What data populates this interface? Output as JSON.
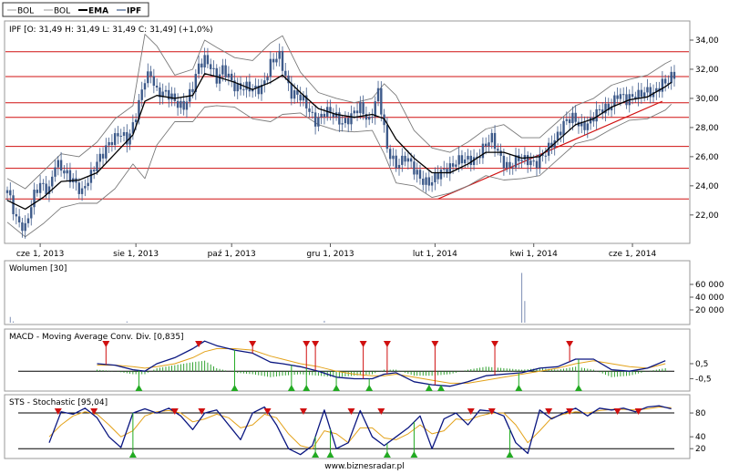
{
  "colors": {
    "price": "#3d5a8a",
    "bollinger": "#7a7a7a",
    "ema": "#000000",
    "resistance": "#d01010",
    "trend": "#d01010",
    "volume": "#7e8fb5",
    "macd_line": "#0a1680",
    "signal_line": "#e3a21a",
    "histogram": "#1f9a1f",
    "sell_marker": "#d01010",
    "buy_marker": "#22aa22",
    "frame": "#9a9a9a"
  },
  "legend": {
    "items": [
      {
        "label": "BOL",
        "style": "thin-gray"
      },
      {
        "label": "BOL",
        "style": "thin-gray"
      },
      {
        "label": "EMA",
        "style": "bold-black"
      },
      {
        "label": "IPF",
        "style": "blue"
      }
    ]
  },
  "footer": "www.biznesradar.pl",
  "chart_data": [
    {
      "type": "line",
      "id": "price",
      "title": "IPF [O: 31,49  H: 31,49  L: 31,49  C: 31,49] (+1,0%)",
      "y_tick_labels": [
        "22,00",
        "24,00",
        "26,00",
        "28,00",
        "30,00",
        "32,00",
        "34,00"
      ],
      "y_ticks": [
        22,
        24,
        26,
        28,
        30,
        32,
        34
      ],
      "ylim": [
        20.3,
        35
      ],
      "x_tick_labels": [
        "cze 1, 2013",
        "sie 1, 2013",
        "paź 1, 2013",
        "gru 1, 2013",
        "lut 1, 2014",
        "kwi 1, 2014",
        "cze 1, 2014"
      ],
      "x_tick_positions": [
        11,
        43,
        75,
        108,
        143,
        176,
        209
      ],
      "x_range": [
        0,
        223
      ],
      "horizontal_levels": [
        23.1,
        25.2,
        26.7,
        28.7,
        29.7,
        31.5,
        33.2
      ],
      "trendline": {
        "x": [
          144,
          219
        ],
        "y": [
          23.1,
          29.8
        ]
      },
      "series": [
        {
          "name": "IPF",
          "x": [
            0,
            3,
            6,
            9,
            11,
            14,
            16,
            19,
            22,
            25,
            28,
            30,
            33,
            36,
            38,
            40,
            42,
            44,
            46,
            48,
            50,
            53,
            56,
            59,
            62,
            64,
            66,
            68,
            70,
            72,
            74,
            76,
            79,
            82,
            85,
            88,
            91,
            93,
            95,
            97,
            100,
            103,
            106,
            109,
            112,
            115,
            118,
            121,
            124,
            127,
            130,
            133,
            136,
            139,
            142,
            144,
            147,
            150,
            153,
            156,
            159,
            162,
            165,
            168,
            171,
            174,
            177,
            180,
            183,
            186,
            189,
            192,
            195,
            198,
            201,
            204,
            207,
            210,
            213,
            216,
            219,
            222
          ],
          "values": [
            23.5,
            21.8,
            21.2,
            23.2,
            24.1,
            23.9,
            25.5,
            24.8,
            24.6,
            23.5,
            24.6,
            25.8,
            26.7,
            27.1,
            27.6,
            27.3,
            28.2,
            29.5,
            31.2,
            31.8,
            30.6,
            30.2,
            29.8,
            29.6,
            30.6,
            32.1,
            32.8,
            32.4,
            31.2,
            31.8,
            31.5,
            31.0,
            30.7,
            30.5,
            30.9,
            32.3,
            32.8,
            31.6,
            30.5,
            30.2,
            29.4,
            28.6,
            29.0,
            28.8,
            28.5,
            28.7,
            29.3,
            28.6,
            30.4,
            26.4,
            25.6,
            25.9,
            25.0,
            24.5,
            24.2,
            24.6,
            25.3,
            25.7,
            25.6,
            25.9,
            26.6,
            27.1,
            26.0,
            25.3,
            25.7,
            25.9,
            25.6,
            26.1,
            27.3,
            28.3,
            28.5,
            28.2,
            28.5,
            29.0,
            29.5,
            30.3,
            29.7,
            30.4,
            30.5,
            30.1,
            31.2,
            31.49
          ]
        },
        {
          "name": "EMA",
          "x": [
            0,
            6,
            12,
            18,
            24,
            30,
            36,
            42,
            46,
            50,
            56,
            62,
            66,
            70,
            76,
            82,
            88,
            92,
            98,
            104,
            110,
            116,
            122,
            126,
            130,
            136,
            142,
            148,
            154,
            160,
            166,
            172,
            178,
            184,
            190,
            196,
            202,
            208,
            214,
            220,
            222
          ],
          "values": [
            23.0,
            22.4,
            23.2,
            24.3,
            24.4,
            24.9,
            26.2,
            27.5,
            29.8,
            30.2,
            30.0,
            30.2,
            31.7,
            31.5,
            31.1,
            30.6,
            31.1,
            31.6,
            30.4,
            29.3,
            28.9,
            28.7,
            28.9,
            28.6,
            27.2,
            25.9,
            24.9,
            24.9,
            25.5,
            26.3,
            26.3,
            25.9,
            26.0,
            27.1,
            28.2,
            28.6,
            29.4,
            29.9,
            30.1,
            30.8,
            31.1
          ]
        },
        {
          "name": "BOL",
          "x": [
            0,
            6,
            12,
            18,
            24,
            30,
            36,
            42,
            46,
            50,
            56,
            62,
            66,
            70,
            76,
            82,
            88,
            92,
            98,
            104,
            110,
            116,
            122,
            126,
            130,
            136,
            142,
            148,
            154,
            160,
            166,
            172,
            178,
            184,
            190,
            196,
            202,
            208,
            214,
            220,
            222
          ],
          "values": [
            24.5,
            23.8,
            25.0,
            26.2,
            26.0,
            27.0,
            28.6,
            29.5,
            34.4,
            33.6,
            31.6,
            32.0,
            34.0,
            33.5,
            32.8,
            32.6,
            33.8,
            34.3,
            31.8,
            30.4,
            30.0,
            29.7,
            30.0,
            31.0,
            30.2,
            27.8,
            26.6,
            26.3,
            27.0,
            27.9,
            28.2,
            27.3,
            27.3,
            28.4,
            29.5,
            30.0,
            30.9,
            31.3,
            31.6,
            32.4,
            32.6
          ]
        },
        {
          "name": "BOL",
          "x": [
            0,
            6,
            12,
            18,
            24,
            30,
            36,
            42,
            46,
            50,
            56,
            62,
            66,
            70,
            76,
            82,
            88,
            92,
            98,
            104,
            110,
            116,
            122,
            126,
            130,
            136,
            142,
            148,
            154,
            160,
            166,
            172,
            178,
            184,
            190,
            196,
            202,
            208,
            214,
            220,
            222
          ],
          "values": [
            21.5,
            20.5,
            21.4,
            22.5,
            22.8,
            22.8,
            23.8,
            25.5,
            24.5,
            26.8,
            28.4,
            28.4,
            29.4,
            29.5,
            29.4,
            28.6,
            28.4,
            28.9,
            29.0,
            28.2,
            27.8,
            27.7,
            27.8,
            26.2,
            24.2,
            24.0,
            23.2,
            23.5,
            24.0,
            24.7,
            24.4,
            24.5,
            24.7,
            25.8,
            26.9,
            27.2,
            27.9,
            28.5,
            28.6,
            29.2,
            29.6
          ]
        }
      ]
    },
    {
      "type": "bar",
      "id": "volume",
      "title": "Wolumen [30]",
      "y_tick_labels": [
        "20 000",
        "40 000",
        "60 000"
      ],
      "y_ticks": [
        20000,
        40000,
        60000
      ],
      "ylim": [
        0,
        80000
      ],
      "x": [
        1,
        2,
        40,
        106,
        172,
        173
      ],
      "values": [
        9000,
        2000,
        2000,
        3000,
        78000,
        34000
      ]
    },
    {
      "type": "line",
      "id": "macd",
      "title": "MACD - Moving Average Conv. Div. [0,835]",
      "y_tick_labels": [
        "0,5",
        "-0,5"
      ],
      "y_ticks": [
        0.5,
        -0.5
      ],
      "ylim": [
        -1.2,
        2.5
      ],
      "series": [
        {
          "name": "MACD",
          "x": [
            30,
            36,
            42,
            46,
            50,
            56,
            62,
            66,
            70,
            76,
            82,
            88,
            92,
            98,
            104,
            110,
            116,
            122,
            126,
            130,
            136,
            142,
            148,
            154,
            160,
            166,
            172,
            178,
            184,
            190,
            196,
            202,
            208,
            214,
            220
          ],
          "values": [
            0.5,
            0.4,
            0.1,
            0.0,
            0.5,
            0.9,
            1.5,
            2.0,
            1.7,
            1.4,
            1.2,
            0.6,
            0.5,
            0.3,
            0.0,
            -0.4,
            -0.5,
            -0.5,
            -0.2,
            -0.1,
            -0.7,
            -0.9,
            -1.0,
            -0.7,
            -0.3,
            -0.2,
            -0.1,
            0.2,
            0.3,
            0.8,
            0.8,
            0.1,
            0.0,
            0.2,
            0.7
          ]
        },
        {
          "name": "Signal",
          "x": [
            30,
            36,
            42,
            46,
            50,
            56,
            62,
            66,
            70,
            76,
            82,
            88,
            92,
            98,
            104,
            110,
            116,
            122,
            126,
            130,
            136,
            142,
            148,
            154,
            160,
            166,
            172,
            178,
            184,
            190,
            196,
            202,
            208,
            214,
            220
          ],
          "values": [
            0.4,
            0.4,
            0.3,
            0.2,
            0.3,
            0.5,
            0.9,
            1.3,
            1.5,
            1.5,
            1.4,
            1.0,
            0.8,
            0.5,
            0.3,
            0.0,
            -0.2,
            -0.3,
            -0.3,
            -0.2,
            -0.4,
            -0.6,
            -0.8,
            -0.8,
            -0.6,
            -0.4,
            -0.2,
            0.0,
            0.2,
            0.5,
            0.7,
            0.5,
            0.3,
            0.2,
            0.5
          ]
        }
      ],
      "sell_signals_x": [
        33,
        64,
        82,
        100,
        103,
        119,
        127,
        143,
        163,
        188
      ],
      "buy_signals_x": [
        44,
        76,
        95,
        100,
        110,
        121,
        141,
        145,
        171,
        191
      ]
    },
    {
      "type": "line",
      "id": "stochastic",
      "title": "STS - Stochastic [95,04]",
      "y_tick_labels": [
        "80",
        "40",
        "20"
      ],
      "y_ticks": [
        80,
        40,
        20
      ],
      "ylim": [
        5,
        100
      ],
      "series": [
        {
          "name": "%K",
          "x": [
            14,
            18,
            22,
            26,
            30,
            34,
            38,
            42,
            46,
            50,
            54,
            58,
            62,
            66,
            70,
            74,
            78,
            82,
            86,
            90,
            94,
            98,
            102,
            106,
            110,
            114,
            118,
            122,
            126,
            130,
            134,
            138,
            142,
            146,
            150,
            154,
            158,
            162,
            166,
            170,
            174,
            178,
            182,
            186,
            190,
            194,
            198,
            202,
            206,
            210,
            214,
            218,
            222
          ],
          "values": [
            30,
            82,
            78,
            88,
            72,
            40,
            22,
            80,
            87,
            80,
            88,
            75,
            52,
            80,
            85,
            60,
            35,
            80,
            90,
            60,
            20,
            10,
            25,
            85,
            20,
            30,
            84,
            40,
            25,
            40,
            55,
            75,
            20,
            70,
            80,
            60,
            85,
            83,
            75,
            30,
            12,
            85,
            70,
            80,
            88,
            75,
            88,
            85,
            88,
            82,
            90,
            92,
            87
          ]
        },
        {
          "name": "%D",
          "x": [
            14,
            18,
            22,
            26,
            30,
            34,
            38,
            42,
            46,
            50,
            54,
            58,
            62,
            66,
            70,
            74,
            78,
            82,
            86,
            90,
            94,
            98,
            102,
            106,
            110,
            114,
            118,
            122,
            126,
            130,
            134,
            138,
            142,
            146,
            150,
            154,
            158,
            162,
            166,
            170,
            174,
            178,
            182,
            186,
            190,
            194,
            198,
            202,
            206,
            210,
            214,
            218,
            222
          ],
          "values": [
            40,
            60,
            75,
            82,
            78,
            60,
            40,
            50,
            75,
            82,
            84,
            80,
            65,
            70,
            78,
            72,
            55,
            60,
            78,
            72,
            45,
            25,
            20,
            50,
            45,
            30,
            55,
            55,
            38,
            35,
            45,
            60,
            45,
            50,
            70,
            68,
            75,
            80,
            80,
            60,
            30,
            50,
            72,
            78,
            82,
            80,
            84,
            86,
            86,
            85,
            87,
            90,
            89
          ]
        }
      ],
      "sell_signals_x": [
        17,
        29,
        56,
        65,
        87,
        99,
        115,
        125,
        155,
        162,
        181,
        188,
        204,
        211
      ],
      "buy_signals_x": [
        42,
        103,
        108,
        127,
        136,
        168
      ]
    }
  ]
}
